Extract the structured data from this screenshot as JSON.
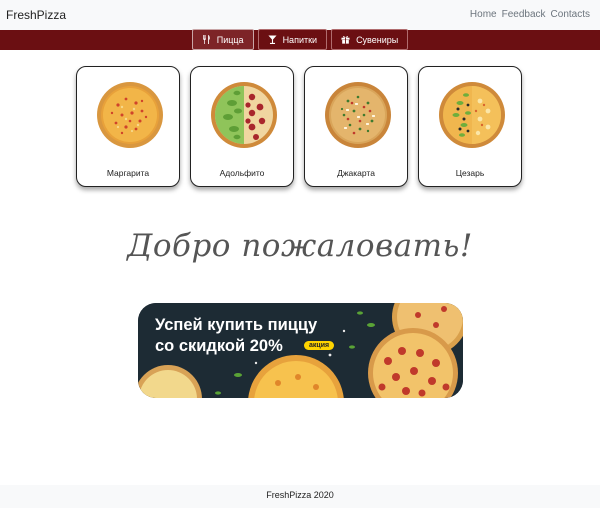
{
  "brand": "FreshPizza",
  "top_nav": {
    "links": [
      "Home",
      "Feedback",
      "Contacts"
    ]
  },
  "categories": [
    {
      "label": "Пицца",
      "icon": "cutlery-icon",
      "active": true
    },
    {
      "label": "Напитки",
      "icon": "cocktail-icon",
      "active": false
    },
    {
      "label": "Сувениры",
      "icon": "gift-icon",
      "active": false
    }
  ],
  "pizzas": [
    {
      "name": "Маргарита"
    },
    {
      "name": "Адольфито"
    },
    {
      "name": "Джакарта"
    },
    {
      "name": "Цезарь"
    }
  ],
  "welcome": "Добро пожаловать!",
  "promo": {
    "line1": "Успей купить пиццу",
    "line2": "со скидкой 20%",
    "badge": "акция"
  },
  "footer": "FreshPizza 2020",
  "colors": {
    "category_bar": "#6b0f12",
    "badge": "#ffd400"
  }
}
